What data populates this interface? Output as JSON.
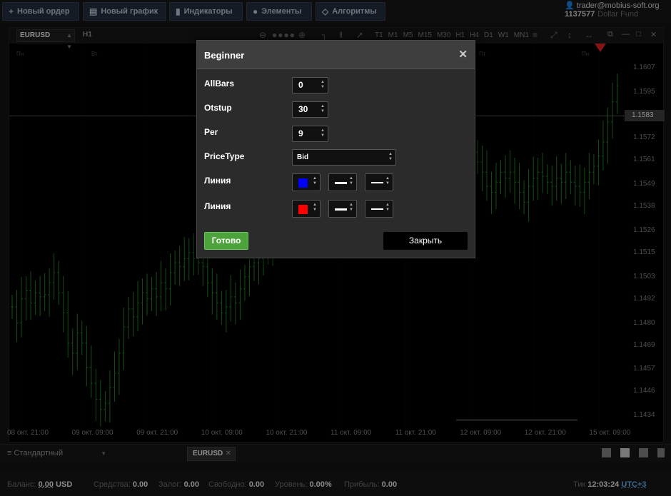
{
  "toolbar": {
    "new_order": "Новый ордер",
    "new_chart": "Новый график",
    "indicators": "Индикаторы",
    "elements": "Элементы",
    "algorithms": "Алгоритмы"
  },
  "account": {
    "email": "trader@mobius-soft.org",
    "number": "1137577",
    "fund": "Dollar Fund"
  },
  "chart": {
    "symbol": "EURUSD",
    "timeframe": "H1",
    "timeframes": [
      "T1",
      "M1",
      "M5",
      "M15",
      "M30",
      "H1",
      "H4",
      "D1",
      "W1",
      "MN1"
    ],
    "current_price": "1.1583",
    "day_labels": [
      "Пн",
      "Вт",
      "Пт",
      "Пн"
    ]
  },
  "chart_data": {
    "type": "bar",
    "price_ticks": [
      "1.1607",
      "1.1595",
      "1.1583",
      "1.1572",
      "1.1561",
      "1.1549",
      "1.1538",
      "1.1526",
      "1.1515",
      "1.1503",
      "1.1492",
      "1.1480",
      "1.1469",
      "1.1457",
      "1.1446",
      "1.1434"
    ],
    "time_ticks": [
      "08 окт. 21:00",
      "09 окт. 09:00",
      "09 окт. 21:00",
      "10 окт. 09:00",
      "10 окт. 21:00",
      "11 окт. 09:00",
      "11 окт. 21:00",
      "12 окт. 09:00",
      "12 окт. 21:00",
      "15 окт. 09:00"
    ],
    "ylim": [
      1.1428,
      1.1619
    ],
    "bar_color": "#1f7a1f",
    "close": [
      1.1488,
      1.148,
      1.1492,
      1.1496,
      1.149,
      1.1495,
      1.1493,
      1.1494,
      1.15,
      1.1505,
      1.1495,
      1.1485,
      1.147,
      1.1465,
      1.1475,
      1.147,
      1.1458,
      1.145,
      1.1442,
      1.1437,
      1.144,
      1.1448,
      1.1455,
      1.1465,
      1.1478,
      1.1487,
      1.1483,
      1.149,
      1.1495,
      1.1492,
      1.1497,
      1.1493,
      1.15,
      1.1497,
      1.1505,
      1.151,
      1.1508,
      1.1512,
      1.1515,
      1.1512,
      1.151,
      1.1508,
      1.15,
      1.1495,
      1.149,
      1.1485,
      1.1488,
      1.1493,
      1.149,
      1.1497,
      1.1503,
      1.1508,
      1.151,
      1.1512,
      1.1515,
      1.1518,
      1.1522,
      1.1528,
      1.1535,
      1.1545,
      1.1555,
      1.1565,
      1.1572,
      1.1578,
      1.1585,
      1.159,
      1.1593,
      1.1597,
      1.16,
      1.1598,
      1.1595,
      1.1593,
      1.159,
      1.1588,
      1.1585,
      1.1583,
      1.1587,
      1.159,
      1.1588,
      1.1585,
      1.1588,
      1.159,
      1.1592,
      1.1595,
      1.159,
      1.1588,
      1.1586,
      1.1584,
      1.1583,
      1.1585,
      1.1583,
      1.158,
      1.1578,
      1.1575,
      1.1572,
      1.158,
      1.1578,
      1.1575,
      1.157,
      1.1565,
      1.156,
      1.1555,
      1.1548,
      1.1545,
      1.155,
      1.1555,
      1.1552,
      1.1555,
      1.155,
      1.1545,
      1.154,
      1.1548,
      1.1552,
      1.1555,
      1.1553,
      1.155,
      1.1548,
      1.1552,
      1.155,
      1.1555,
      1.155,
      1.1548,
      1.1545,
      1.155,
      1.1555,
      1.1558,
      1.1563,
      1.157,
      1.158,
      1.159,
      1.1598
    ]
  },
  "dialog": {
    "title": "Beginner",
    "params": [
      {
        "label": "AllBars",
        "value": "0"
      },
      {
        "label": "Otstup",
        "value": "30"
      },
      {
        "label": "Per",
        "value": "9"
      },
      {
        "label": "PriceType",
        "value": "Bid"
      },
      {
        "label": "Линия",
        "color": "#0000ff"
      },
      {
        "label": "Линия",
        "color": "#ff0000"
      }
    ],
    "ok_label": "Готово",
    "close_label": "Закрыть"
  },
  "bottom": {
    "layout": "Стандартный",
    "tab": "EURUSD"
  },
  "status": {
    "balance_label": "Баланс:",
    "balance_value": "0.00",
    "balance_currency": "USD",
    "funds_label": "Средства:",
    "funds_value": "0.00",
    "margin_label": "Залог:",
    "margin_value": "0.00",
    "free_label": "Свободно:",
    "free_value": "0.00",
    "level_label": "Уровень:",
    "level_value": "0.00%",
    "profit_label": "Прибыль:",
    "profit_value": "0.00",
    "tick_label": "Тик",
    "time": "12:03:24",
    "tz": "UTC+3"
  }
}
